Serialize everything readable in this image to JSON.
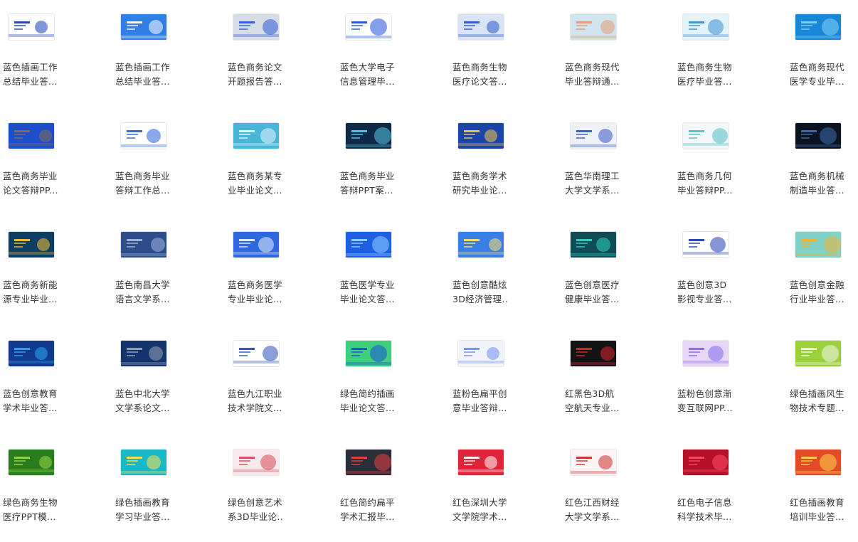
{
  "files": [
    {
      "l1": "蓝色插画工作",
      "l2": "总结毕业答...",
      "bg": "#ffffff",
      "accent": "#1a3fb5",
      "icon": "file-thumbnail-icon"
    },
    {
      "l1": "蓝色插画工作",
      "l2": "总结毕业答...",
      "bg": "#2f7fe6",
      "accent": "#ffffff",
      "icon": "file-thumbnail-icon"
    },
    {
      "l1": "蓝色商务论文",
      "l2": "开题报告答...",
      "bg": "#d7dde6",
      "accent": "#2a5bd7",
      "icon": "file-thumbnail-icon"
    },
    {
      "l1": "蓝色大学电子",
      "l2": "信息管理毕...",
      "bg": "#ffffff",
      "accent": "#1d4fd8",
      "icon": "file-thumbnail-icon"
    },
    {
      "l1": "蓝色商务生物",
      "l2": "医疗论文答...",
      "bg": "#d9e4f6",
      "accent": "#2a58c8",
      "icon": "file-thumbnail-icon"
    },
    {
      "l1": "蓝色商务现代",
      "l2": "毕业答辩通...",
      "bg": "#cfe6f0",
      "accent": "#e49a72",
      "icon": "file-thumbnail-icon"
    },
    {
      "l1": "蓝色商务生物",
      "l2": "医疗毕业答...",
      "bg": "#e4f2fa",
      "accent": "#3a8fd6",
      "icon": "file-thumbnail-icon"
    },
    {
      "l1": "蓝色商务现代",
      "l2": "医学专业毕...",
      "bg": "#1a86d6",
      "accent": "#7fd3f7",
      "icon": "file-thumbnail-icon"
    },
    {
      "l1": "蓝色商务毕业",
      "l2": "论文答辩PP...",
      "bg": "#1d4fcc",
      "accent": "#8a6b4a",
      "icon": "file-thumbnail-icon"
    },
    {
      "l1": "蓝色商务毕业",
      "l2": "答辩工作总...",
      "bg": "#ffffff",
      "accent": "#2a63d6",
      "icon": "file-thumbnail-icon"
    },
    {
      "l1": "蓝色商务某专",
      "l2": "业毕业论文...",
      "bg": "#46b7d8",
      "accent": "#e9f6fb",
      "icon": "file-thumbnail-icon"
    },
    {
      "l1": "蓝色商务毕业",
      "l2": "答辩PPT案...",
      "bg": "#0e2a46",
      "accent": "#58c7e8",
      "icon": "file-thumbnail-icon"
    },
    {
      "l1": "蓝色商务学术",
      "l2": "研究毕业论...",
      "bg": "#1b44a8",
      "accent": "#f5c842",
      "icon": "file-thumbnail-icon"
    },
    {
      "l1": "蓝色华南理工",
      "l2": "大学文学系...",
      "bg": "#eef1f8",
      "accent": "#3456c9",
      "icon": "file-thumbnail-icon"
    },
    {
      "l1": "蓝色商务几何",
      "l2": "毕业答辩PP...",
      "bg": "#f4f7f9",
      "accent": "#4fc1c9",
      "icon": "file-thumbnail-icon"
    },
    {
      "l1": "蓝色商务机械",
      "l2": "制造毕业答...",
      "bg": "#0b1220",
      "accent": "#3a6fb0",
      "icon": "file-thumbnail-icon"
    },
    {
      "l1": "蓝色商务新能",
      "l2": "源专业毕业...",
      "bg": "#0e3d66",
      "accent": "#f2c230",
      "icon": "file-thumbnail-icon"
    },
    {
      "l1": "蓝色南昌大学",
      "l2": "语言文学系...",
      "bg": "#2d4c8a",
      "accent": "#9fb5dd",
      "icon": "file-thumbnail-icon"
    },
    {
      "l1": "蓝色商务医学",
      "l2": "专业毕业论...",
      "bg": "#2f67e0",
      "accent": "#e8eef8",
      "icon": "file-thumbnail-icon"
    },
    {
      "l1": "蓝色医学专业",
      "l2": "毕业论文答...",
      "bg": "#1f5fe3",
      "accent": "#8fd0ff",
      "icon": "file-thumbnail-icon"
    },
    {
      "l1": "蓝色创意酷炫",
      "l2": "3D经济管理..",
      "bg": "#3a7fe8",
      "accent": "#ffe066",
      "icon": "file-thumbnail-icon"
    },
    {
      "l1": "蓝色创意医疗",
      "l2": "健康毕业答...",
      "bg": "#0f4c55",
      "accent": "#2fd0c0",
      "icon": "file-thumbnail-icon"
    },
    {
      "l1": "蓝色创意3D",
      "l2": "影视专业答...",
      "bg": "#ffffff",
      "accent": "#1f3fb0",
      "icon": "file-thumbnail-icon"
    },
    {
      "l1": "蓝色创意金融",
      "l2": "行业毕业答...",
      "bg": "#7fd3c8",
      "accent": "#f2b533",
      "icon": "file-thumbnail-icon"
    },
    {
      "l1": "蓝色创意教育",
      "l2": "学术毕业答...",
      "bg": "#123a8c",
      "accent": "#2aa7f0",
      "icon": "file-thumbnail-icon"
    },
    {
      "l1": "蓝色中北大学",
      "l2": "文学系论文...",
      "bg": "#14346e",
      "accent": "#9aa4b5",
      "icon": "file-thumbnail-icon"
    },
    {
      "l1": "蓝色九江职业",
      "l2": "技术学院文...",
      "bg": "#ffffff",
      "accent": "#2a4fb8",
      "icon": "file-thumbnail-icon"
    },
    {
      "l1": "绿色简约插画",
      "l2": "毕业论文答...",
      "bg": "#3cd07c",
      "accent": "#1f4fd8",
      "icon": "file-thumbnail-icon"
    },
    {
      "l1": "蓝粉色扁平创",
      "l2": "意毕业答辩...",
      "bg": "#f1f4fb",
      "accent": "#6f8ef0",
      "icon": "file-thumbnail-icon"
    },
    {
      "l1": "红黑色3D航",
      "l2": "空航天专业...",
      "bg": "#141414",
      "accent": "#d8252c",
      "icon": "file-thumbnail-icon"
    },
    {
      "l1": "蓝粉色创意渐",
      "l2": "变互联网PP...",
      "bg": "#e8d7f6",
      "accent": "#7d6cf0",
      "icon": "file-thumbnail-icon"
    },
    {
      "l1": "绿色插画风生",
      "l2": "物技术专题...",
      "bg": "#9bd13a",
      "accent": "#f6f6f0",
      "icon": "file-thumbnail-icon"
    },
    {
      "l1": "绿色商务生物",
      "l2": "医疗PPT模...",
      "bg": "#2a7d1e",
      "accent": "#9bd64a",
      "icon": "file-thumbnail-icon"
    },
    {
      "l1": "绿色插画教育",
      "l2": "学习毕业答...",
      "bg": "#19b8c6",
      "accent": "#ffe04a",
      "icon": "file-thumbnail-icon"
    },
    {
      "l1": "绿色创意艺术",
      "l2": "系3D毕业论..",
      "bg": "#f7e9ec",
      "accent": "#d94a58",
      "icon": "file-thumbnail-icon"
    },
    {
      "l1": "红色简约扁平",
      "l2": "学术汇报毕...",
      "bg": "#2a2d3a",
      "accent": "#e8423c",
      "icon": "file-thumbnail-icon"
    },
    {
      "l1": "红色深圳大学",
      "l2": "文学院学术...",
      "bg": "#e2243a",
      "accent": "#ffffff",
      "icon": "file-thumbnail-icon"
    },
    {
      "l1": "红色江西财经",
      "l2": "大学文学系...",
      "bg": "#fbf5f5",
      "accent": "#d02a2a",
      "icon": "file-thumbnail-icon"
    },
    {
      "l1": "红色电子信息",
      "l2": "科学技术毕...",
      "bg": "#b5102a",
      "accent": "#ff4a6a",
      "icon": "file-thumbnail-icon"
    },
    {
      "l1": "红色插画教育",
      "l2": "培训毕业答...",
      "bg": "#e24a28",
      "accent": "#ffd54a",
      "icon": "file-thumbnail-icon"
    }
  ]
}
